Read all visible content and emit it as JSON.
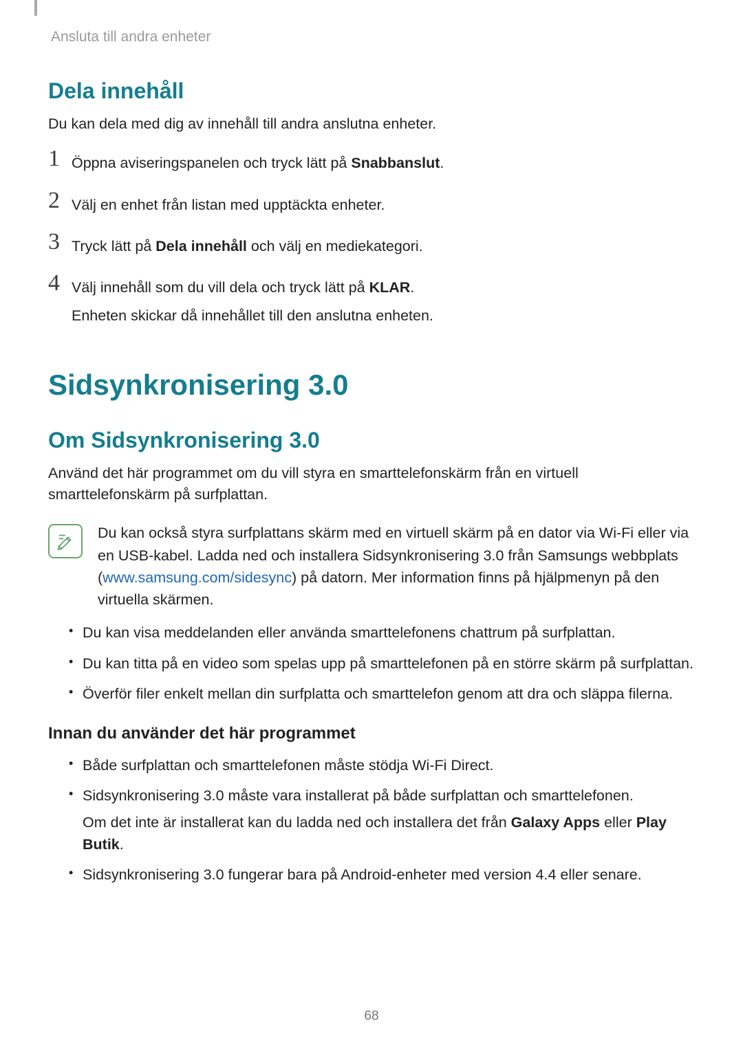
{
  "header": "Ansluta till andra enheter",
  "section1": {
    "title": "Dela innehåll",
    "intro": "Du kan dela med dig av innehåll till andra anslutna enheter.",
    "steps": [
      {
        "num": "1",
        "pre": "Öppna aviseringspanelen och tryck lätt på ",
        "bold": "Snabbanslut",
        "post": "."
      },
      {
        "num": "2",
        "text": "Välj en enhet från listan med upptäckta enheter."
      },
      {
        "num": "3",
        "pre": "Tryck lätt på ",
        "bold": "Dela innehåll",
        "post": " och välj en mediekategori."
      },
      {
        "num": "4",
        "pre": "Välj innehåll som du vill dela och tryck lätt på ",
        "bold": "KLAR",
        "post": ".",
        "sub": "Enheten skickar då innehållet till den anslutna enheten."
      }
    ]
  },
  "section2": {
    "title": "Sidsynkronisering 3.0",
    "sub1": {
      "title": "Om Sidsynkronisering 3.0",
      "intro": "Använd det här programmet om du vill styra en smarttelefonskärm från en virtuell smarttelefonskärm på surfplattan.",
      "note_pre": "Du kan också styra surfplattans skärm med en virtuell skärm på en dator via Wi-Fi eller via en USB-kabel. Ladda ned och installera Sidsynkronisering 3.0 från Samsungs webbplats (",
      "note_link": "www.samsung.com/sidesync",
      "note_post": ") på datorn. Mer information finns på hjälpmenyn på den virtuella skärmen.",
      "bullets": [
        "Du kan visa meddelanden eller använda smarttelefonens chattrum på surfplattan.",
        "Du kan titta på en video som spelas upp på smarttelefonen på en större skärm på surfplattan.",
        "Överför filer enkelt mellan din surfplatta och smarttelefon genom att dra och släppa filerna."
      ]
    },
    "sub2": {
      "title": "Innan du använder det här programmet",
      "b1": "Både surfplattan och smarttelefonen måste stödja Wi-Fi Direct.",
      "b2": "Sidsynkronisering 3.0 måste vara installerat på både surfplattan och smarttelefonen.",
      "b2_sub_pre": "Om det inte är installerat kan du ladda ned och installera det från ",
      "b2_bold1": "Galaxy Apps",
      "b2_mid": " eller ",
      "b2_bold2": "Play Butik",
      "b2_end": ".",
      "b3": "Sidsynkronisering 3.0 fungerar bara på Android-enheter med version 4.4 eller senare."
    }
  },
  "pageNumber": "68"
}
